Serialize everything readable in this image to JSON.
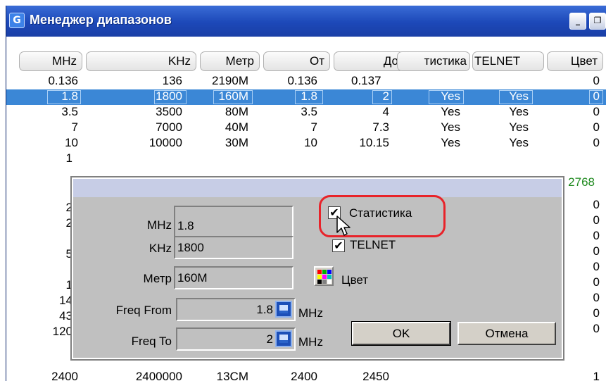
{
  "window": {
    "title": "Менеджер диапазонов",
    "icon_glyph": "G",
    "minimize_glyph": "_",
    "restore_glyph": "❐"
  },
  "table": {
    "columns": [
      "MHz",
      "KHz",
      "Метр",
      "От",
      "До",
      "тистика",
      "TELNET",
      "Цвет"
    ],
    "rows": [
      [
        "0.136",
        "136",
        "2190M",
        "0.136",
        "0.137",
        "",
        "",
        "0"
      ],
      [
        "1.8",
        "1800",
        "160M",
        "1.8",
        "2",
        "Yes",
        "Yes",
        "0"
      ],
      [
        "3.5",
        "3500",
        "80M",
        "3.5",
        "4",
        "Yes",
        "Yes",
        "0"
      ],
      [
        "7",
        "7000",
        "40M",
        "7",
        "7.3",
        "Yes",
        "Yes",
        "0"
      ],
      [
        "10",
        "10000",
        "30M",
        "10",
        "10.15",
        "Yes",
        "Yes",
        "0"
      ]
    ],
    "selected_row": 1,
    "partial_left_chars": [
      "1",
      "2",
      "2",
      "5",
      "1",
      "14",
      "43",
      "120"
    ],
    "right_values": [
      "2768",
      "0",
      "0",
      "0",
      "0",
      "0",
      "0",
      "0",
      "0",
      "0",
      "1"
    ],
    "bottom_row": [
      "2400",
      "2400000",
      "13CM",
      "2400",
      "2450",
      "",
      "",
      "1"
    ],
    "green_color": "#1f8a1f"
  },
  "dialog": {
    "mhz_label": "MHz",
    "mhz_value": "1.8",
    "khz_label": "KHz",
    "khz_value": "1800",
    "meter_label": "Метр",
    "meter_value": "160M",
    "freq_from_label": "Freq From",
    "freq_from_value": "1.8",
    "freq_from_unit": "MHz",
    "freq_to_label": "Freq To",
    "freq_to_value": "2",
    "freq_to_unit": "MHz",
    "stats_label": "Статистика",
    "stats_checked": true,
    "telnet_label": "TELNET",
    "telnet_checked": true,
    "color_label": "Цвет",
    "ok_label": "OK",
    "cancel_label": "Отмена",
    "check_glyph": "✔"
  },
  "colors": {
    "selection": "#3b87d6",
    "highlight_ring": "#e8232a",
    "titlebar": "#1c48b8"
  }
}
